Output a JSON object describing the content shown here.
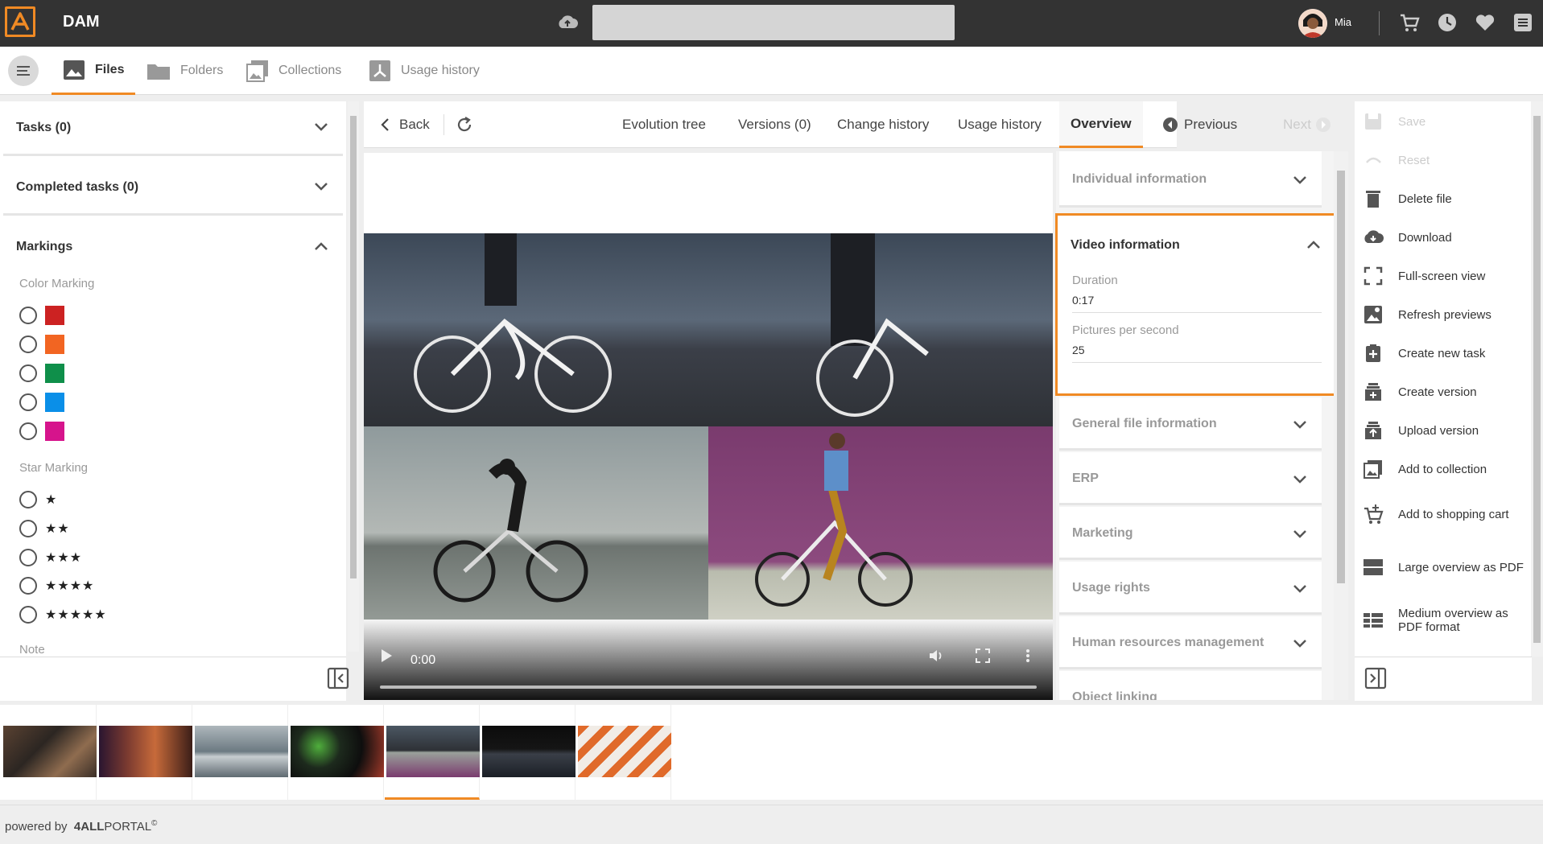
{
  "app": {
    "title": "DAM",
    "user": "Mia"
  },
  "nav": {
    "tabs": [
      {
        "label": "Files",
        "active": true
      },
      {
        "label": "Folders"
      },
      {
        "label": "Collections"
      },
      {
        "label": "Usage history"
      }
    ]
  },
  "left": {
    "tasks": "Tasks (0)",
    "completed_tasks": "Completed tasks (0)",
    "markings": "Markings",
    "color_marking": "Color Marking",
    "colors": [
      "#cc2222",
      "#f26522",
      "#0f8f4a",
      "#0a8fe8",
      "#d6148c"
    ],
    "star_marking": "Star Marking",
    "stars": [
      "★",
      "★★",
      "★★★",
      "★★★★",
      "★★★★★"
    ],
    "note": "Note"
  },
  "detail_header": {
    "back": "Back",
    "evolution_tree": "Evolution tree",
    "versions": "Versions (0)",
    "change_history": "Change history",
    "usage_history": "Usage history",
    "overview": "Overview",
    "previous": "Previous",
    "next": "Next"
  },
  "video": {
    "time": "0:00"
  },
  "info": {
    "individual": "Individual information",
    "video_info": {
      "title": "Video information",
      "duration_label": "Duration",
      "duration_value": "0:17",
      "fps_label": "Pictures per second",
      "fps_value": "25"
    },
    "general": "General file information",
    "erp": "ERP",
    "marketing": "Marketing",
    "usage_rights": "Usage rights",
    "hr": "Human resources management",
    "object_linking": "Object linking"
  },
  "actions": {
    "save": "Save",
    "reset": "Reset",
    "delete": "Delete file",
    "download": "Download",
    "fullscreen": "Full-screen view",
    "refresh_previews": "Refresh previews",
    "create_task": "Create new task",
    "create_version": "Create version",
    "upload_version": "Upload version",
    "add_collection": "Add to collection",
    "add_cart": "Add to shopping cart",
    "large_pdf": "Large overview as PDF",
    "medium_pdf": "Medium overview as PDF format"
  },
  "footer": {
    "powered_by": "powered by",
    "brand_bold": "4ALL",
    "brand_rest": "PORTAL",
    "brand_mark": "©"
  },
  "colors": {
    "accent": "#f08a24",
    "topbar": "#333333"
  }
}
